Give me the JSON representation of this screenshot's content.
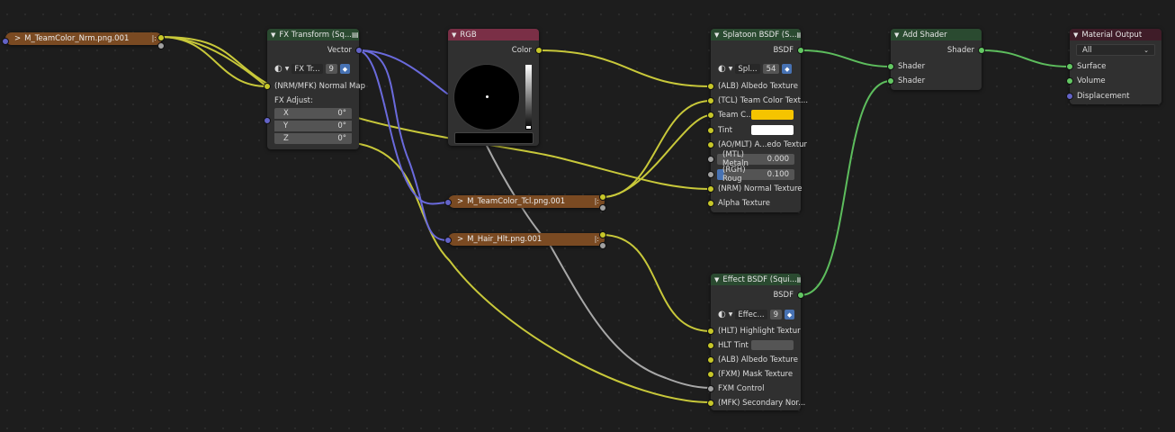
{
  "frames": {
    "teamcolor_nrm": "M_TeamColor_Nrm.png.001",
    "teamcolor_tcl": "M_TeamColor_Tcl.png.001",
    "hair_hlt": "M_Hair_Hlt.png.001",
    "marker": "|:"
  },
  "fx_transform": {
    "title": "FX Transform (Sq...",
    "vector": "Vector",
    "group_name": "FX Tr...",
    "users": "9",
    "normal_map": "(NRM/MFK) Normal Map",
    "fx_adjust": "FX Adjust:",
    "x_label": "X",
    "x_value": "0°",
    "y_label": "Y",
    "y_value": "0°",
    "z_label": "Z",
    "z_value": "0°"
  },
  "rgb": {
    "title": "RGB",
    "color": "Color"
  },
  "splatoon": {
    "title": "Splatoon BSDF (S...",
    "bsdf": "BSDF",
    "group_name": "Spl...",
    "users": "54",
    "albedo": "(ALB) Albedo Texture",
    "team_color_tex": "(TCL) Team Color Text...",
    "team_color": "Team C...",
    "tint": "Tint",
    "ao": "(AO/MLT) A...edo Textur",
    "metal_label": "(MTL) Metaln",
    "metal_value": "0.000",
    "rough_label": "(RGH) Roug",
    "rough_value": "0.100",
    "normal_tex": "(NRM) Normal Texture",
    "alpha_tex": "Alpha Texture"
  },
  "add_shader": {
    "title": "Add Shader",
    "out": "Shader",
    "in1": "Shader",
    "in2": "Shader"
  },
  "material_output": {
    "title": "Material Output",
    "target": "All",
    "surface": "Surface",
    "volume": "Volume",
    "displacement": "Displacement"
  },
  "effect": {
    "title": "Effect BSDF (Squi...",
    "bsdf": "BSDF",
    "group_name": "Effec...",
    "users": "9",
    "highlight": "(HLT) Highlight Textur",
    "hlt_tint": "HLT Tint",
    "albedo": "(ALB) Albedo Texture",
    "mask": "(FXM) Mask Texture",
    "control": "FXM Control",
    "secondary": "(MFK) Secondary Nor..."
  },
  "colors": {
    "socket_color": "#c7c729",
    "socket_vector": "#6363c7",
    "socket_shader": "#63c763",
    "socket_float": "#a1a1a1",
    "team_color_swatch": "#f5c400",
    "tint_swatch": "#ffffff",
    "hlt_tint_swatch": "#555555",
    "frame_orange": "#7a4a22"
  },
  "icons": {
    "collapse": "chevron-right-icon",
    "node_group": "node-group-icon",
    "datablock": "sphere-icon",
    "fake_user": "shield-icon",
    "dropdown": "chevron-down-icon"
  }
}
